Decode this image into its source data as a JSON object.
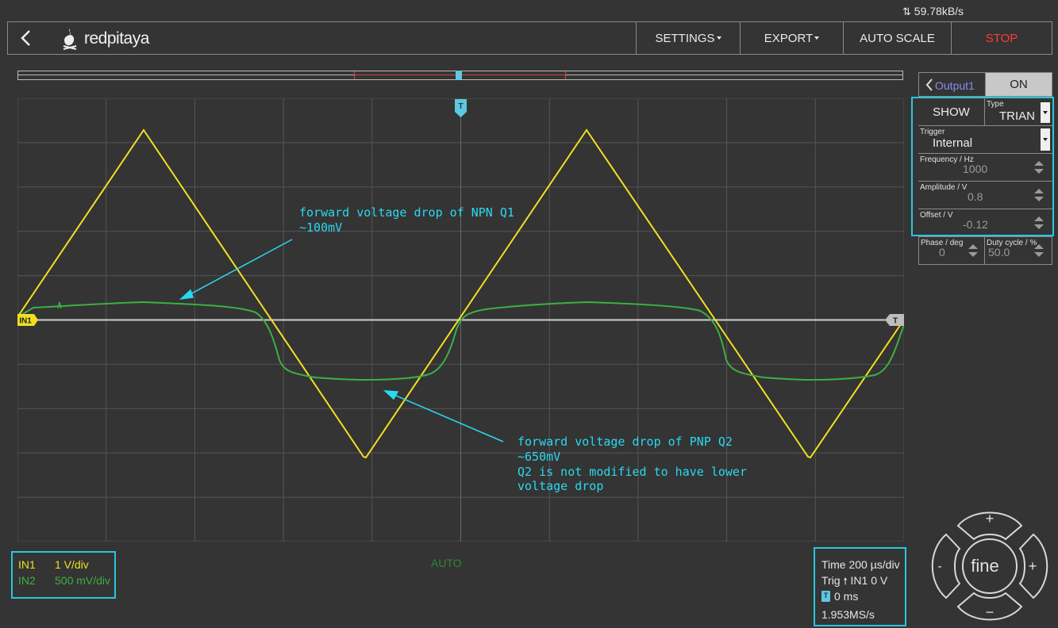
{
  "status": {
    "net_speed": "59.78kB/s"
  },
  "header": {
    "logo_text": "redpitaya",
    "settings_label": "SETTINGS",
    "export_label": "EXPORT",
    "autoscale_label": "AUTO SCALE",
    "stop_label": "STOP"
  },
  "plot": {
    "trigger_marker": "T",
    "in1_marker": "IN1",
    "trigger_level_marker": "T",
    "annotation_npn_line1": "forward voltage drop of NPN Q1",
    "annotation_npn_line2": "~100mV",
    "annotation_pnp_line1": "forward voltage drop of PNP Q2",
    "annotation_pnp_line2": "~650mV",
    "annotation_pnp_line3": "Q2 is not modified to have lower",
    "annotation_pnp_line4": "voltage drop",
    "colors": {
      "in1": "#f0e020",
      "in2": "#3cb043",
      "annotation": "#29d9f0"
    },
    "in1_scale_v_per_div": 1,
    "in2_scale_mv_per_div": 500
  },
  "channels": {
    "in1_label": "IN1",
    "in1_scale": "1 V/div",
    "in2_label": "IN2",
    "in2_scale": "500 mV/div"
  },
  "mode": "AUTO",
  "timebase": {
    "time": "Time 200 µs/div",
    "trig": "Trig",
    "trig_source": "IN1 0 V",
    "delay": "0 ms",
    "sample_rate": "1.953MS/s"
  },
  "output_panel": {
    "tab_label": "Output1",
    "on_label": "ON",
    "show_label": "SHOW",
    "type_label": "Type",
    "type_value": "TRIAN",
    "trigger_label": "Trigger",
    "trigger_value": "Internal",
    "frequency_label": "Frequency / Hz",
    "frequency_value": "1000",
    "amplitude_label": "Amplitude / V",
    "amplitude_value": "0.8",
    "offset_label": "Offset / V",
    "offset_value": "-0.12",
    "phase_label": "Phase / deg",
    "phase_value": "0",
    "duty_label": "Duty cycle / %",
    "duty_value": "50.0"
  },
  "jog": {
    "plus": "+",
    "minus": "−",
    "left": "-",
    "right": "+",
    "center": "fine"
  }
}
